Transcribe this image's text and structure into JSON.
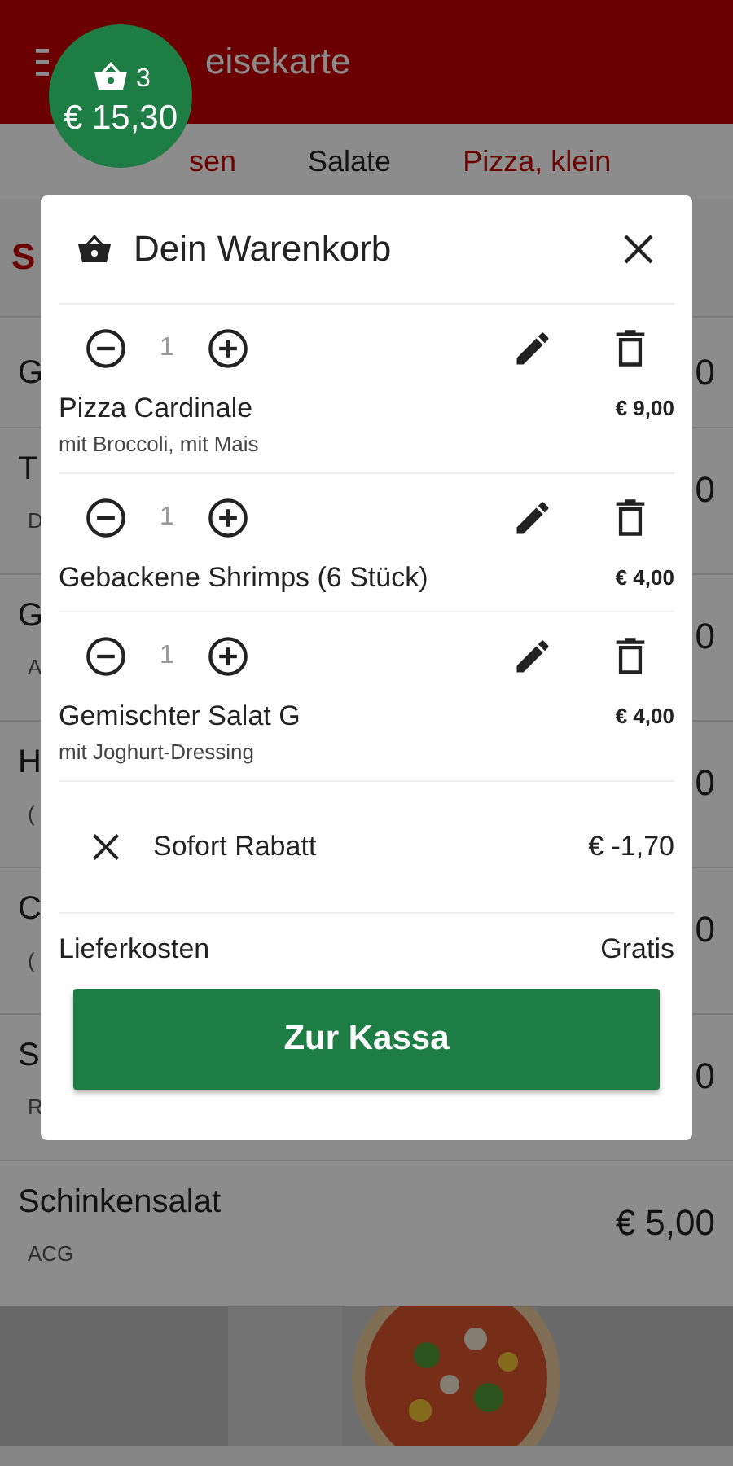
{
  "app_bar": {
    "title": "eisekarte"
  },
  "cart_badge": {
    "count": "3",
    "total": "€ 15,30"
  },
  "tabs": [
    {
      "label": "sen",
      "selected": false
    },
    {
      "label": "Salate",
      "selected": true
    },
    {
      "label": "Pizza, klein",
      "selected": false
    }
  ],
  "section": {
    "title": "S"
  },
  "menu_items": [
    {
      "name": "G",
      "price": "0"
    },
    {
      "name": "T",
      "note": "D",
      "price": "0"
    },
    {
      "name": "G",
      "note": "A",
      "price": "0"
    },
    {
      "name": "H",
      "note": "(",
      "price": "0"
    },
    {
      "name": "C",
      "note": "(",
      "price": "0"
    },
    {
      "name": "S",
      "note": "R",
      "price": "0"
    },
    {
      "name": "Schinkensalat",
      "note": "ACG",
      "price": "€ 5,00"
    }
  ],
  "cart": {
    "title": "Dein Warenkorb",
    "items": [
      {
        "quantity": "1",
        "name": "Pizza Cardinale",
        "options": "mit Broccoli, mit Mais",
        "price": "€ 9,00"
      },
      {
        "quantity": "1",
        "name": "Gebackene Shrimps (6 Stück)",
        "price": "€ 4,00"
      },
      {
        "quantity": "1",
        "name": "Gemischter Salat G",
        "options": "mit Joghurt-Dressing",
        "price": "€ 4,00"
      }
    ],
    "discount": {
      "label": "Sofort Rabatt",
      "amount": "€ -1,70"
    },
    "delivery": {
      "label": "Lieferkosten",
      "value": "Gratis"
    },
    "checkout_button": "Zur Kassa"
  }
}
